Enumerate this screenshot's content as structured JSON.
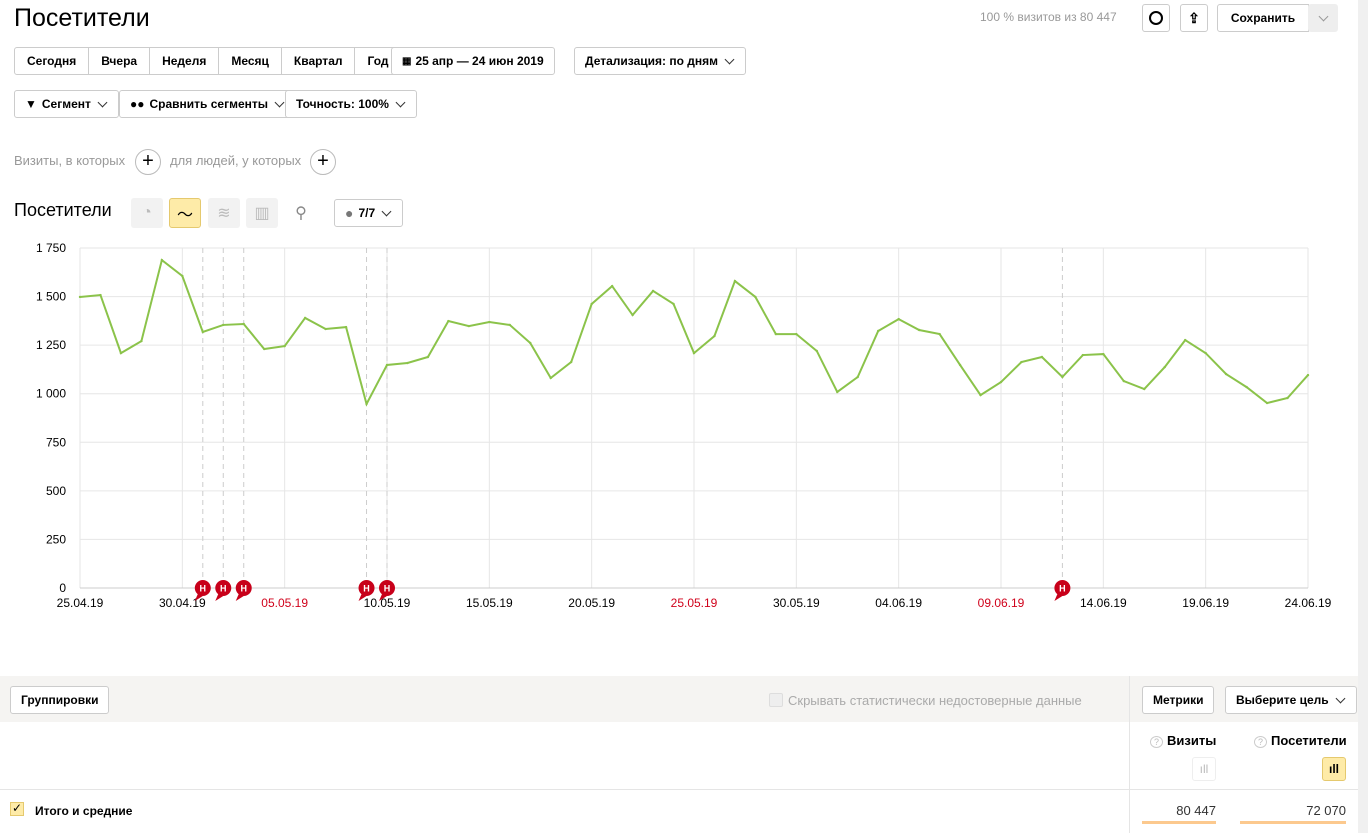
{
  "header": {
    "title": "Посетители",
    "sample_info": "100 % визитов из 80 447",
    "save_label": "Сохранить",
    "history_icon": "clock-icon",
    "export_icon": "share-icon"
  },
  "periods": [
    "Сегодня",
    "Вчера",
    "Неделя",
    "Месяц",
    "Квартал",
    "Год"
  ],
  "date_range": "25 апр — 24 июн 2019",
  "detail": "Детализация: по дням",
  "filters": {
    "segment": "Сегмент",
    "compare": "Сравнить сегменты",
    "accuracy": "Точность: 100%"
  },
  "conditions": {
    "visits": "Визиты, в которых",
    "people": "для людей, у которых"
  },
  "chart_header": {
    "title": "Посетители",
    "notes": "7/7",
    "view_types": [
      "pie",
      "line",
      "area",
      "bar",
      "map"
    ],
    "active_view": "line"
  },
  "chart_data": {
    "type": "line",
    "xlabel": "",
    "ylabel": "",
    "ylim": [
      0,
      1750
    ],
    "yticks": [
      "0",
      "250",
      "500",
      "750",
      "1 000",
      "1 250",
      "1 500",
      "1 750"
    ],
    "xtick_labels": [
      "25.04.19",
      "30.04.19",
      "05.05.19",
      "10.05.19",
      "15.05.19",
      "20.05.19",
      "25.05.19",
      "30.05.19",
      "04.06.19",
      "09.06.19",
      "14.06.19",
      "19.06.19",
      "24.06.19"
    ],
    "xtick_holiday": [
      false,
      false,
      true,
      false,
      false,
      false,
      true,
      false,
      false,
      true,
      false,
      false,
      false
    ],
    "x_start": "25.04.19",
    "x_end": "24.06.19",
    "grid": true,
    "color": "#8bc34a",
    "values": [
      1498,
      1508,
      1209,
      1271,
      1688,
      1606,
      1318,
      1354,
      1359,
      1230,
      1245,
      1390,
      1333,
      1343,
      947,
      1148,
      1158,
      1189,
      1374,
      1348,
      1369,
      1354,
      1261,
      1081,
      1163,
      1462,
      1554,
      1405,
      1529,
      1462,
      1209,
      1297,
      1580,
      1498,
      1307,
      1307,
      1220,
      1009,
      1086,
      1323,
      1384,
      1328,
      1307,
      1148,
      993,
      1060,
      1163,
      1189,
      1086,
      1199,
      1204,
      1065,
      1024,
      1137,
      1276,
      1209,
      1101,
      1034,
      952,
      978,
      1096
    ],
    "annotation_dates": [
      "01.05.19",
      "02.05.19",
      "03.05.19",
      "09.05.19",
      "10.05.19",
      "12.06.19"
    ],
    "annotation_label": "Н"
  },
  "table": {
    "groupings": "Группировки",
    "hide_unreliable": "Скрывать статистически недостоверные данные",
    "metrics": "Метрики",
    "goal": "Выберите цель",
    "columns": [
      "Визиты",
      "Посетители"
    ],
    "total_label": "Итого и средние",
    "totals": [
      "80 447",
      "72 070"
    ]
  }
}
